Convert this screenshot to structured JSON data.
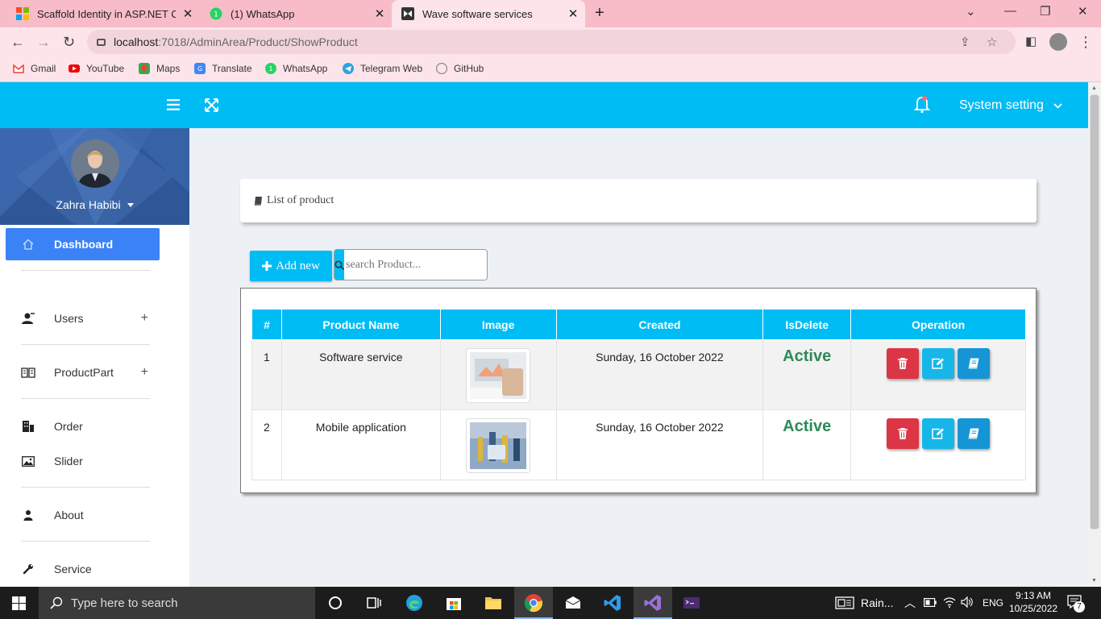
{
  "browser": {
    "tabs": [
      {
        "title": "Scaffold Identity in ASP.NET Core",
        "active": false
      },
      {
        "title": "(1) WhatsApp",
        "active": false
      },
      {
        "title": "Wave software services",
        "active": true
      }
    ],
    "url_host": "localhost",
    "url_path": ":7018/AdminArea/Product/ShowProduct",
    "bookmarks": [
      "Gmail",
      "YouTube",
      "Maps",
      "Translate",
      "WhatsApp",
      "Telegram Web",
      "GitHub"
    ]
  },
  "topbar": {
    "system_setting": "System setting"
  },
  "sidebar": {
    "user_name": "Zahra Habibi",
    "items": [
      {
        "label": "Dashboard",
        "icon": "home-icon"
      },
      {
        "label": "Users",
        "icon": "users-icon"
      },
      {
        "label": "ProductPart",
        "icon": "book-icon"
      },
      {
        "label": "Order",
        "icon": "building-icon"
      },
      {
        "label": "Slider",
        "icon": "image-icon"
      },
      {
        "label": "About",
        "icon": "user-icon"
      },
      {
        "label": "Service",
        "icon": "wrench-icon"
      }
    ]
  },
  "main": {
    "header_title": "List of product",
    "add_new": "Add new",
    "search_placeholder": "search Product...",
    "table": {
      "headers": [
        "#",
        "Product Name",
        "Image",
        "Created",
        "IsDelete",
        "Operation"
      ],
      "rows": [
        {
          "num": "1",
          "name": "Software service",
          "created": "Sunday, 16 October 2022",
          "status": "Active"
        },
        {
          "num": "2",
          "name": "Mobile application",
          "created": "Sunday, 16 October 2022",
          "status": "Active"
        }
      ]
    }
  },
  "taskbar": {
    "search_placeholder": "Type here to search",
    "weather": "Rain...",
    "lang": "ENG",
    "time": "9:13 AM",
    "date": "10/25/2022",
    "notifications": "7"
  },
  "colors": {
    "accent": "#00bcf5",
    "active_nav": "#3b82f6",
    "status_active": "#2e8b57",
    "delete": "#dc3545"
  }
}
